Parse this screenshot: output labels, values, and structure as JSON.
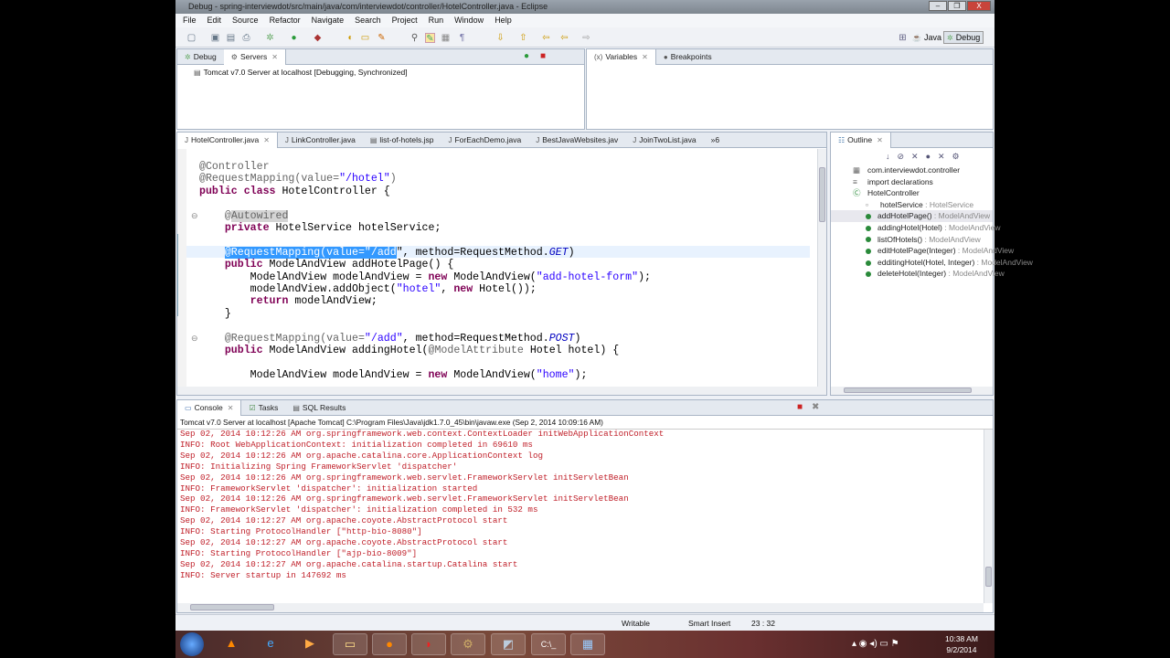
{
  "window": {
    "title": "Debug - spring-interviewdot/src/main/java/com/interviewdot/controller/HotelController.java - Eclipse",
    "min": "–",
    "max": "❐",
    "close": "X"
  },
  "menu": [
    "File",
    "Edit",
    "Source",
    "Refactor",
    "Navigate",
    "Search",
    "Project",
    "Run",
    "Window",
    "Help"
  ],
  "perspectives": {
    "java": "Java",
    "debug": "Debug"
  },
  "debug_panel": {
    "tabs": [
      "Debug",
      "Servers"
    ],
    "server": "Tomcat v7.0 Server at localhost  [Debugging, Synchronized]"
  },
  "variables_panel": {
    "tabs": [
      "Variables",
      "Breakpoints"
    ]
  },
  "editor": {
    "tabs": [
      "HotelController.java",
      "LinkController.java",
      "list-of-hotels.jsp",
      "ForEachDemo.java",
      "BestJavaWebsites.jav",
      "JoinTwoList.java"
    ],
    "overflow": "»6",
    "lines": [
      [
        [
          "@Controller",
          "an"
        ]
      ],
      [
        [
          "@RequestMapping(value=",
          "an"
        ],
        [
          "\"/hotel\"",
          "st"
        ],
        [
          ")",
          "an"
        ]
      ],
      [
        [
          "public class ",
          "kw"
        ],
        [
          "HotelController {",
          ""
        ]
      ],
      [
        [
          "",
          ""
        ]
      ],
      [
        [
          "    ",
          ""
        ],
        [
          "@",
          "an"
        ],
        [
          "Autowired",
          "an ann-hl"
        ]
      ],
      [
        [
          "    ",
          ""
        ],
        [
          "private ",
          "kw"
        ],
        [
          "HotelService hotelService;",
          ""
        ]
      ],
      [
        [
          "",
          ""
        ]
      ],
      [
        [
          "    ",
          ""
        ],
        [
          "@RequestMapping(value=\"/add",
          "sel"
        ],
        [
          "\", method=RequestMethod.",
          ""
        ],
        [
          "GET",
          "it"
        ],
        [
          ")",
          ""
        ]
      ],
      [
        [
          "    ",
          ""
        ],
        [
          "public ",
          "kw"
        ],
        [
          "ModelAndView addHotelPage() {",
          ""
        ]
      ],
      [
        [
          "        ModelAndView modelAndView = ",
          ""
        ],
        [
          "new ",
          "kw"
        ],
        [
          "ModelAndView(",
          ""
        ],
        [
          "\"add-hotel-form\"",
          "st"
        ],
        [
          ");",
          ""
        ]
      ],
      [
        [
          "        modelAndView.addObject(",
          ""
        ],
        [
          "\"hotel\"",
          "st"
        ],
        [
          ", ",
          ""
        ],
        [
          "new ",
          "kw"
        ],
        [
          "Hotel());",
          ""
        ]
      ],
      [
        [
          "        ",
          ""
        ],
        [
          "return ",
          "kw"
        ],
        [
          "modelAndView;",
          ""
        ]
      ],
      [
        [
          "    }",
          ""
        ]
      ],
      [
        [
          "",
          ""
        ]
      ],
      [
        [
          "    ",
          ""
        ],
        [
          "@RequestMapping(value=",
          "an"
        ],
        [
          "\"/add\"",
          "st"
        ],
        [
          ", method=RequestMethod.",
          ""
        ],
        [
          "POST",
          "it"
        ],
        [
          ")",
          ""
        ]
      ],
      [
        [
          "    ",
          ""
        ],
        [
          "public ",
          "kw"
        ],
        [
          "ModelAndView addingHotel(",
          ""
        ],
        [
          "@ModelAttribute",
          "an"
        ],
        [
          " Hotel hotel) {",
          ""
        ]
      ],
      [
        [
          "",
          ""
        ]
      ],
      [
        [
          "        ModelAndView modelAndView = ",
          ""
        ],
        [
          "new ",
          "kw"
        ],
        [
          "ModelAndView(",
          ""
        ],
        [
          "\"home\"",
          "st"
        ],
        [
          ");",
          ""
        ]
      ]
    ]
  },
  "outline": {
    "title": "Outline",
    "items": [
      {
        "name": "com.interviewdot.controller",
        "type": "",
        "icon": "package-icon"
      },
      {
        "name": "import declarations",
        "type": "",
        "icon": "imports-icon"
      },
      {
        "name": "HotelController",
        "type": "",
        "icon": "class-icon"
      },
      {
        "name": "hotelService",
        "type": " : HotelService",
        "icon": "field-icon"
      },
      {
        "name": "addHotelPage()",
        "type": " : ModelAndView",
        "icon": "method-icon"
      },
      {
        "name": "addingHotel(Hotel)",
        "type": " : ModelAndView",
        "icon": "method-icon"
      },
      {
        "name": "listOfHotels()",
        "type": " : ModelAndView",
        "icon": "method-icon"
      },
      {
        "name": "editHotelPage(Integer)",
        "type": " : ModelAndView",
        "icon": "method-icon"
      },
      {
        "name": "edditingHotel(Hotel, Integer)",
        "type": " : ModelAndView",
        "icon": "method-icon"
      },
      {
        "name": "deleteHotel(Integer)",
        "type": " : ModelAndView",
        "icon": "method-icon"
      }
    ]
  },
  "console": {
    "tabs": [
      "Console",
      "Tasks",
      "SQL Results"
    ],
    "header": "Tomcat v7.0 Server at localhost [Apache Tomcat] C:\\Program Files\\Java\\jdk1.7.0_45\\bin\\javaw.exe (Sep 2, 2014 10:09:16 AM)",
    "lines": [
      "Sep 02, 2014 10:12:26 AM org.springframework.web.context.ContextLoader initWebApplicationContext",
      "INFO: Root WebApplicationContext: initialization completed in 69610 ms",
      "Sep 02, 2014 10:12:26 AM org.apache.catalina.core.ApplicationContext log",
      "INFO: Initializing Spring FrameworkServlet 'dispatcher'",
      "Sep 02, 2014 10:12:26 AM org.springframework.web.servlet.FrameworkServlet initServletBean",
      "INFO: FrameworkServlet 'dispatcher': initialization started",
      "Sep 02, 2014 10:12:26 AM org.springframework.web.servlet.FrameworkServlet initServletBean",
      "INFO: FrameworkServlet 'dispatcher': initialization completed in 532 ms",
      "Sep 02, 2014 10:12:27 AM org.apache.coyote.AbstractProtocol start",
      "INFO: Starting ProtocolHandler [\"http-bio-8080\"]",
      "Sep 02, 2014 10:12:27 AM org.apache.coyote.AbstractProtocol start",
      "INFO: Starting ProtocolHandler [\"ajp-bio-8009\"]",
      "Sep 02, 2014 10:12:27 AM org.apache.catalina.startup.Catalina start",
      "INFO: Server startup in 147692 ms"
    ]
  },
  "status": {
    "writable": "Writable",
    "insert_mode": "Smart Insert",
    "position": "23 : 32"
  },
  "taskbar": {
    "time": "10:38 AM",
    "date": "9/2/2014",
    "apps": [
      "start-button",
      "vlc",
      "internet-explorer",
      "media-player",
      "file-explorer",
      "firefox",
      "filezilla",
      "eclipse",
      "notepad",
      "command-prompt",
      "movie-maker"
    ]
  }
}
